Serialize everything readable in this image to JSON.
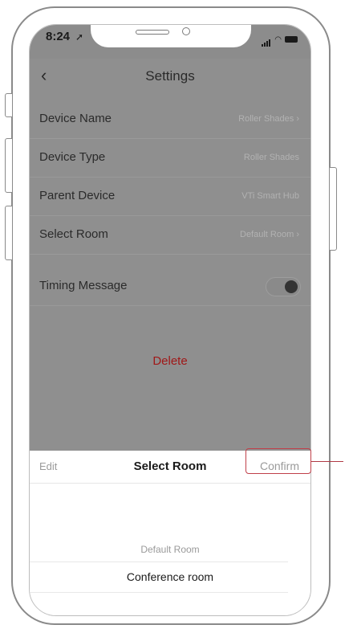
{
  "status_bar": {
    "time": "8:24"
  },
  "nav": {
    "back_icon": "chevron-left-icon",
    "title": "Settings"
  },
  "settings_rows": [
    {
      "label": "Device Name",
      "value": "Roller Shades"
    },
    {
      "label": "Device Type",
      "value": "Roller Shades"
    },
    {
      "label": "Parent Device",
      "value": "VTi Smart Hub"
    },
    {
      "label": "Select Room",
      "value": "Default Room"
    }
  ],
  "timing": {
    "label": "Timing Message",
    "enabled": true
  },
  "delete_label": "Delete",
  "sheet": {
    "edit_label": "Edit",
    "title": "Select Room",
    "confirm_label": "Confirm",
    "options": [
      "Default Room",
      "Conference room"
    ],
    "selected": "Conference room"
  },
  "colors": {
    "overlay": "#8f8f8f",
    "delete": "#a01818",
    "highlight": "#c0404a"
  }
}
